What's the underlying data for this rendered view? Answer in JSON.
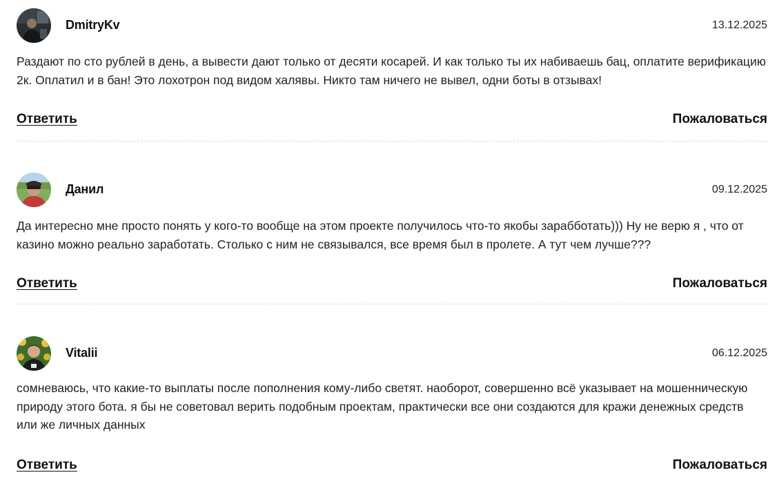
{
  "comments": [
    {
      "author": "DmitryKv",
      "date": "13.12.2025",
      "text": "Раздают по сто рублей в день, а вывести дают только от десяти косарей. И как только ты их набиваешь бац, оплатите верификацию 2к. Оплатил и в бан! Это лохотрон под видом халявы. Никто там ничего не вывел, одни боты в отзывах!",
      "reply_label": "Ответить",
      "report_label": "Пожаловаться"
    },
    {
      "author": "Данил",
      "date": "09.12.2025",
      "text": "Да интересно мне просто понять у кого-то вообще на этом проекте получилось что-то якобы зарабботать))) Ну не верю я , что от казино можно реально заработать. Столько с ним не связывался, все время был в пролете. А тут чем лучше???",
      "reply_label": "Ответить",
      "report_label": "Пожаловаться"
    },
    {
      "author": "Vitalii",
      "date": "06.12.2025",
      "text": "сомневаюсь, что какие-то выплаты после пополнения кому-либо светят. наоборот, совершенно всё указывает на мошенническую природу этого бота. я бы не советовал верить подобным проектам, практически все они создаются для кражи денежных средств или же личных данных",
      "reply_label": "Ответить",
      "report_label": "Пожаловаться"
    }
  ]
}
